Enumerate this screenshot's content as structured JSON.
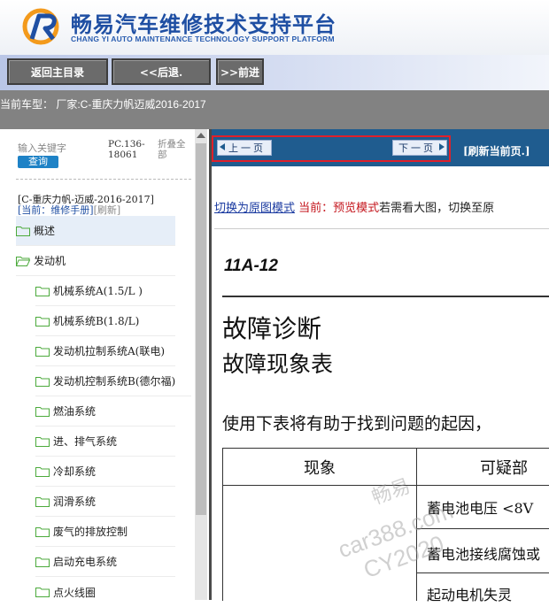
{
  "header": {
    "title_cn": "畅易汽车维修技术支持平台",
    "title_en": "CHANG YI AUTO MAINTENANCE TECHNOLOGY SUPPORT PLATFORM"
  },
  "nav": {
    "home": "返回主目录",
    "back": "<<后退.",
    "forward": ">>前进"
  },
  "current_vehicle": "当前车型： 厂家:C-重庆力帆迈威2016-2017",
  "sidebar": {
    "search_placeholder": "输入关键字",
    "search_button": "查询",
    "pc_code": "PC.136-18061",
    "fold_all": "折叠全部",
    "breadcrumb_vehicle": "[C-重庆力帆-迈威-2016-2017]",
    "breadcrumb_current": "[当前：维修手册]",
    "breadcrumb_refresh": "[刷新]",
    "items": [
      {
        "label": "概述"
      },
      {
        "label": "发动机"
      },
      {
        "label": "机械系统A(1.5/L )"
      },
      {
        "label": "机械系统B(1.8/L)"
      },
      {
        "label": "发动机拉制系统A(联电)"
      },
      {
        "label": "发动机控制系统B(德尔福)"
      },
      {
        "label": "燃油系统"
      },
      {
        "label": "进、排气系统"
      },
      {
        "label": "冷却系统"
      },
      {
        "label": "润滑系统"
      },
      {
        "label": "废气的排放控制"
      },
      {
        "label": "启动充电系统"
      },
      {
        "label": "点火线圈"
      }
    ]
  },
  "pager": {
    "prev": "上一页",
    "next": "下一页",
    "refresh": "[刷新当前页.]"
  },
  "mode": {
    "switch_link": "切换为原图模式",
    "current": "当前：预览模式",
    "hint": "若需看大图，切换至原"
  },
  "document": {
    "code": "11A-12",
    "h1": "故障诊断",
    "h2": "故障现象表",
    "intro": "使用下表将有助于找到问题的起因，",
    "table_headers": [
      "现象",
      "可疑部"
    ],
    "rows": [
      "蓄电池电压 <8V",
      "蓄电池接线腐蚀或",
      "起动电机失灵"
    ]
  },
  "watermark": {
    "line1": "畅易",
    "line2": "car388.com",
    "line3": "CY2020"
  },
  "colors": {
    "brand_blue": "#1f4fa3",
    "pager_bar": "#1f5c8f",
    "highlight_red": "#e0202a",
    "mode_red": "#c4151c"
  }
}
